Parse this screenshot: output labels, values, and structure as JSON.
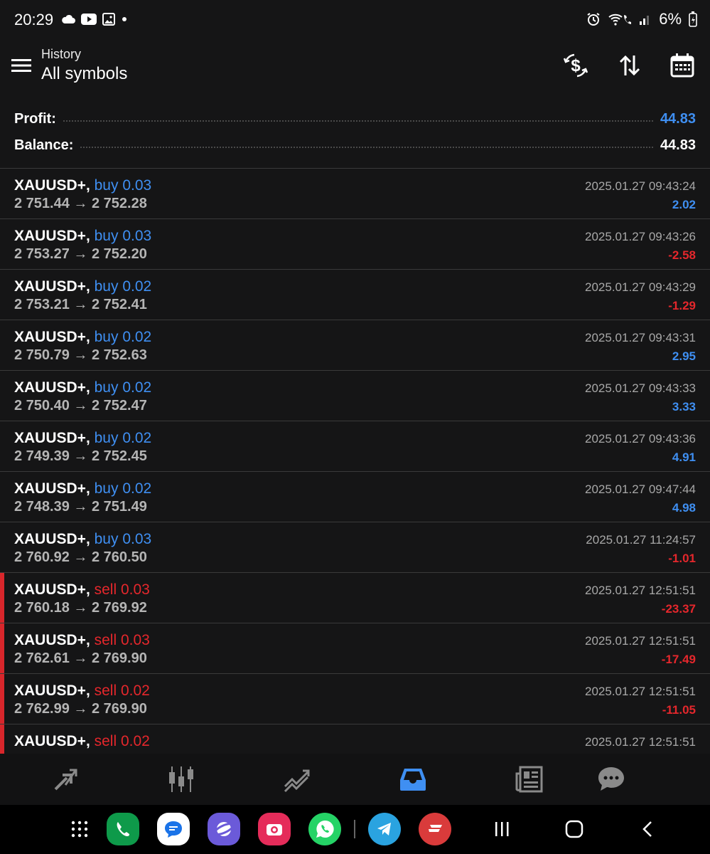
{
  "status_bar": {
    "time": "20:29",
    "battery": "6%"
  },
  "header": {
    "subtitle": "History",
    "title": "All symbols"
  },
  "summary": {
    "profit_label": "Profit:",
    "profit_value": "44.83",
    "balance_label": "Balance:",
    "balance_value": "44.83"
  },
  "deals": [
    {
      "symbol": "XAUUSD+,",
      "type": "buy 0.03",
      "prices": "2 751.44 → 2 752.28",
      "time": "2025.01.27 09:43:24",
      "profit": "2.02"
    },
    {
      "symbol": "XAUUSD+,",
      "type": "buy 0.03",
      "prices": "2 753.27 → 2 752.20",
      "time": "2025.01.27 09:43:26",
      "profit": "-2.58"
    },
    {
      "symbol": "XAUUSD+,",
      "type": "buy 0.02",
      "prices": "2 753.21 → 2 752.41",
      "time": "2025.01.27 09:43:29",
      "profit": "-1.29"
    },
    {
      "symbol": "XAUUSD+,",
      "type": "buy 0.02",
      "prices": "2 750.79 → 2 752.63",
      "time": "2025.01.27 09:43:31",
      "profit": "2.95"
    },
    {
      "symbol": "XAUUSD+,",
      "type": "buy 0.02",
      "prices": "2 750.40 → 2 752.47",
      "time": "2025.01.27 09:43:33",
      "profit": "3.33"
    },
    {
      "symbol": "XAUUSD+,",
      "type": "buy 0.02",
      "prices": "2 749.39 → 2 752.45",
      "time": "2025.01.27 09:43:36",
      "profit": "4.91"
    },
    {
      "symbol": "XAUUSD+,",
      "type": "buy 0.02",
      "prices": "2 748.39 → 2 751.49",
      "time": "2025.01.27 09:47:44",
      "profit": "4.98"
    },
    {
      "symbol": "XAUUSD+,",
      "type": "buy 0.03",
      "prices": "2 760.92 → 2 760.50",
      "time": "2025.01.27 11:24:57",
      "profit": "-1.01"
    },
    {
      "symbol": "XAUUSD+,",
      "type": "sell 0.03",
      "prices": "2 760.18 → 2 769.92",
      "time": "2025.01.27 12:51:51",
      "profit": "-23.37"
    },
    {
      "symbol": "XAUUSD+,",
      "type": "sell 0.03",
      "prices": "2 762.61 → 2 769.90",
      "time": "2025.01.27 12:51:51",
      "profit": "-17.49"
    },
    {
      "symbol": "XAUUSD+,",
      "type": "sell 0.02",
      "prices": "2 762.99 → 2 769.90",
      "time": "2025.01.27 12:51:51",
      "profit": "-11.05"
    },
    {
      "symbol": "XAUUSD+,",
      "type": "sell 0.02",
      "prices": "",
      "time": "2025.01.27 12:51:51",
      "profit": ""
    }
  ],
  "bottom_tabs": [
    {
      "name": "quotes-tab",
      "icon": "arrows-icon"
    },
    {
      "name": "chart-tab",
      "icon": "candlestick-icon"
    },
    {
      "name": "trade-tab",
      "icon": "trend-icon"
    },
    {
      "name": "history-tab",
      "icon": "inbox-icon",
      "active": true
    },
    {
      "name": "news-tab",
      "icon": "newspaper-icon"
    },
    {
      "name": "chat-tab",
      "icon": "chat-icon"
    }
  ],
  "colors": {
    "buy": "#3f8ff2",
    "sell": "#e5272c",
    "background": "#151516",
    "active_tab": "#3f8ff2"
  }
}
